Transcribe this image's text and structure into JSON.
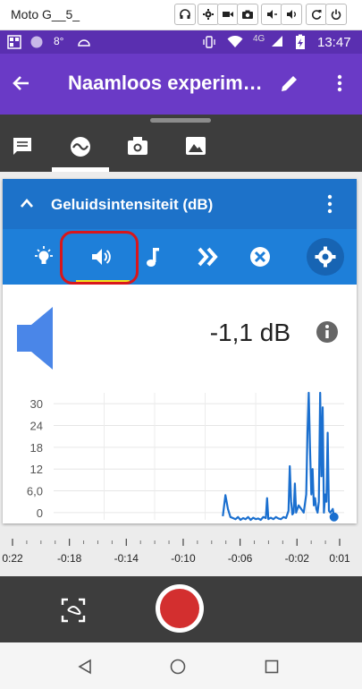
{
  "emulator": {
    "title": "Moto G__5_"
  },
  "status_bar": {
    "time": "13:47",
    "network": "4G",
    "notification_temp": "8°"
  },
  "app_bar": {
    "title": "Naamloos experim…"
  },
  "sensor_card": {
    "title": "Geluidsintensiteit (dB)",
    "selected_sensor": "sound",
    "reading": "-1,1 dB"
  },
  "chart_data": {
    "type": "line",
    "y_ticks": [
      "30",
      "24",
      "18",
      "12",
      "6,0",
      "0"
    ],
    "ylim": [
      -2,
      33
    ],
    "x_ticks": [
      "0:22",
      "-0:18",
      "-0:14",
      "-0:10",
      "-0:06",
      "-0:02",
      "0:01"
    ],
    "xlim": [
      -22,
      1
    ],
    "grid": true,
    "series": [
      {
        "x": [
          -8.6,
          -8.4,
          -8.2,
          -8.0,
          -7.8,
          -7.6,
          -7.4,
          -7.2,
          -7.0,
          -6.8,
          -6.6,
          -6.4,
          -6.2,
          -6.0,
          -5.8,
          -5.6,
          -5.4,
          -5.2,
          -5.1,
          -5.0,
          -4.8,
          -4.6,
          -4.4,
          -4.2,
          -4.0,
          -3.8,
          -3.6,
          -3.4,
          -3.3,
          -3.2,
          -3.1,
          -3.0,
          -2.9,
          -2.8,
          -2.6,
          -2.4,
          -2.2,
          -2.0,
          -1.9,
          -1.8,
          -1.7,
          -1.6,
          -1.5,
          -1.4,
          -1.3,
          -1.2,
          -1.1,
          -1.0,
          -0.9,
          -0.8,
          -0.7,
          -0.6,
          -0.5,
          -0.4,
          -0.3,
          -0.2,
          -0.1,
          0.0,
          0.1,
          0.2
        ],
        "y": [
          -1,
          4.8,
          1,
          -1.2,
          -1.5,
          -1.8,
          -1.2,
          -2,
          -1.5,
          -1.8,
          -1.2,
          -2,
          -1.4,
          -1.8,
          -1.6,
          -2,
          -1.2,
          -1.5,
          4,
          -1.8,
          -1.4,
          -1.8,
          -1.2,
          -1.6,
          -1.8,
          -1.2,
          -1.5,
          0.5,
          12.8,
          3,
          -0.5,
          0,
          8,
          0,
          2,
          1,
          0,
          5,
          22,
          33,
          18,
          5,
          12,
          2,
          4,
          1,
          0,
          3,
          33,
          10,
          29,
          0,
          5,
          3,
          22,
          0.5,
          0,
          0.5,
          1,
          -1.2
        ]
      }
    ]
  },
  "icons": {
    "back": "arrow-back-icon",
    "edit": "pencil-icon",
    "more": "more-vert-icon"
  }
}
